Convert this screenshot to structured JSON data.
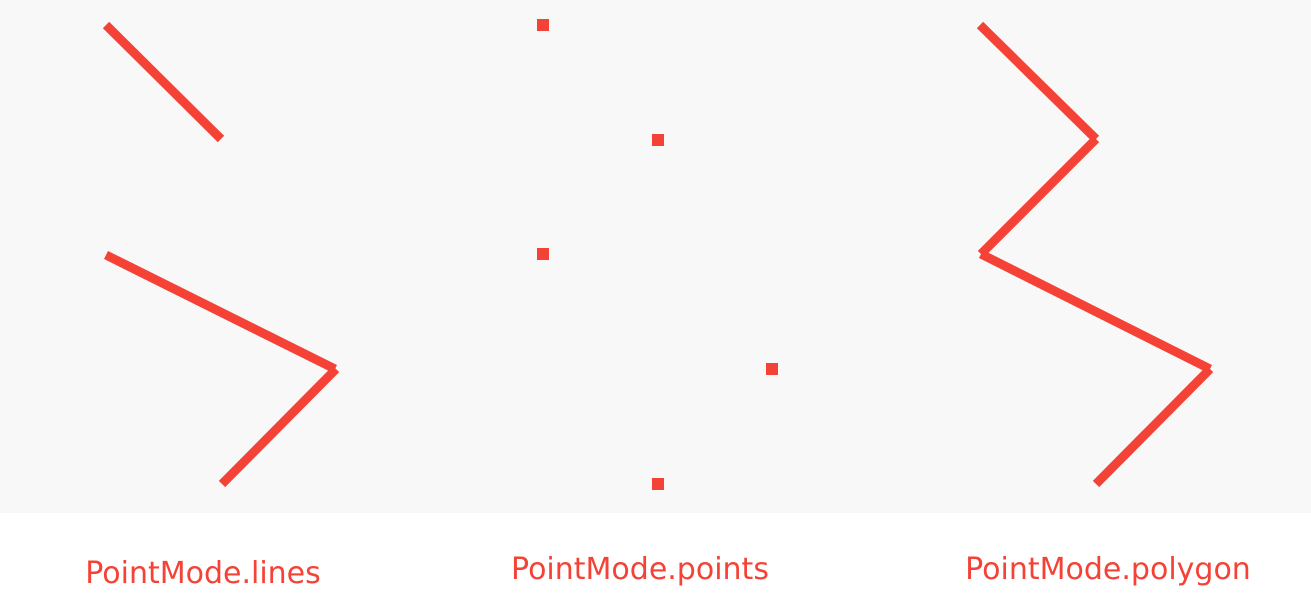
{
  "colors": {
    "accent": "#f44336",
    "canvas_background": "#f9f8f9",
    "page_background": "#ffffff"
  },
  "captions": {
    "lines": "PointMode.lines",
    "points": "PointMode.points",
    "polygon": "PointMode.polygon"
  },
  "panels": [
    {
      "mode": "lines",
      "description": "points drawn as separate line segments (pairs)"
    },
    {
      "mode": "points",
      "description": "points drawn as individual squares"
    },
    {
      "mode": "polygon",
      "description": "points connected in sequence"
    }
  ]
}
